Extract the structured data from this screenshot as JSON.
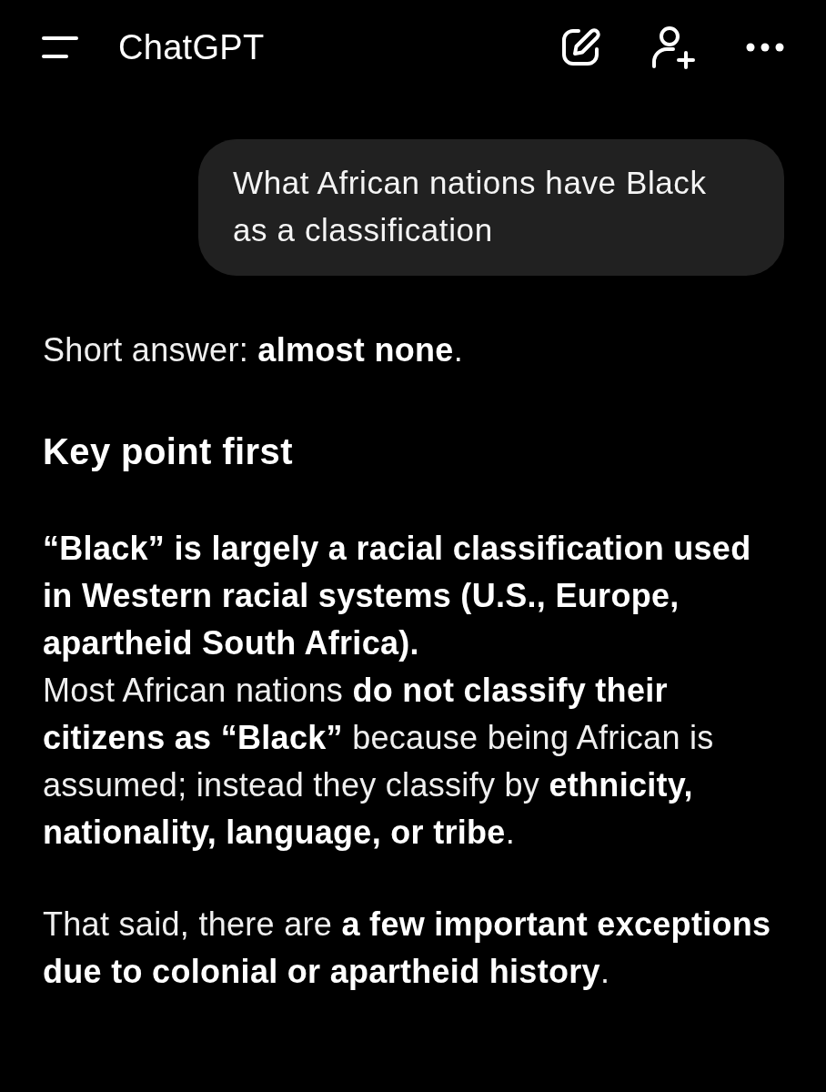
{
  "header": {
    "title": "ChatGPT"
  },
  "user_message": {
    "text": "What African nations have Black as a classification"
  },
  "assistant_message": {
    "blocks": [
      {
        "kind": "paragraph",
        "text": "Short answer: **almost none**."
      },
      {
        "kind": "heading",
        "text": "Key point first"
      },
      {
        "kind": "paragraph",
        "text": "**“Black” is largely a racial classification used in Western racial systems (U.S., Europe, apartheid South Africa).**\nMost African nations **do not classify their citizens as “Black”** because being African is assumed; instead they classify by **ethnicity, nationality, language, or tribe**."
      },
      {
        "kind": "paragraph",
        "text": "That said, there are **a few important exceptions due to colonial or apartheid history**."
      }
    ]
  }
}
